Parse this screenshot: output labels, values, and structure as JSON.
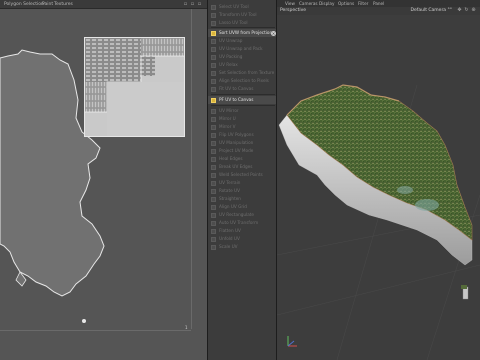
{
  "uv_editor": {
    "menu": [
      "Polygon Selection",
      "Paint",
      "Textures"
    ],
    "axis_label": "1"
  },
  "tool_panel": {
    "rows": [
      {
        "label": "Select UV Tool",
        "active": false
      },
      {
        "label": "Transform UV Tool",
        "active": false
      },
      {
        "label": "Lasso UV Tool",
        "active": false
      },
      {
        "label": "Sort UVW from Projection",
        "active": true
      },
      {
        "label": "UV Unwrap",
        "active": false
      },
      {
        "label": "UV Unwrap and Pack",
        "active": false
      },
      {
        "label": "UV Packing",
        "active": false
      },
      {
        "label": "UV Relax",
        "active": false
      },
      {
        "label": "Set Selection from Texture",
        "active": false
      },
      {
        "label": "Align Selection to Pixels",
        "active": false
      },
      {
        "label": "Fit UV to Canvas",
        "active": false
      },
      {
        "label": "PF UV to Canvas",
        "active": true
      },
      {
        "label": "UV Mirror",
        "active": false
      },
      {
        "label": "Mirror U",
        "active": false
      },
      {
        "label": "Mirror V",
        "active": false
      },
      {
        "label": "Flip UV Polygons",
        "active": false
      },
      {
        "label": "UV Manipulation",
        "active": false
      },
      {
        "label": "Project UV Mode",
        "active": false
      },
      {
        "label": "Heal Edges",
        "active": false
      },
      {
        "label": "Break UV Edges",
        "active": false
      },
      {
        "label": "Weld Selected Points",
        "active": false
      },
      {
        "label": "UV Terrain",
        "active": false
      },
      {
        "label": "Rotate UV",
        "active": false
      },
      {
        "label": "Straighten",
        "active": false
      },
      {
        "label": "Align UV Grid",
        "active": false
      },
      {
        "label": "UV Rectangulate",
        "active": false
      },
      {
        "label": "Auto UV Transform",
        "active": false
      },
      {
        "label": "Flatten UV",
        "active": false
      },
      {
        "label": "Unfold UV",
        "active": false
      },
      {
        "label": "Scale UV",
        "active": false
      }
    ]
  },
  "viewport": {
    "menu": [
      "View",
      "Cameras",
      "Display",
      "Options",
      "Filter",
      "Panel"
    ],
    "title": "Perspective",
    "camera": "Default Camera °°"
  },
  "colors": {
    "uv_bg": "#555555",
    "island_fill": "#707070",
    "island_stroke": "#e8e8e8",
    "active_icon": "#d9b33a",
    "terrain_green": "#4f6b34",
    "cliff": "#d8d8d8"
  },
  "icons": {
    "close": "close-icon",
    "axis": "axis-gizmo-icon"
  }
}
